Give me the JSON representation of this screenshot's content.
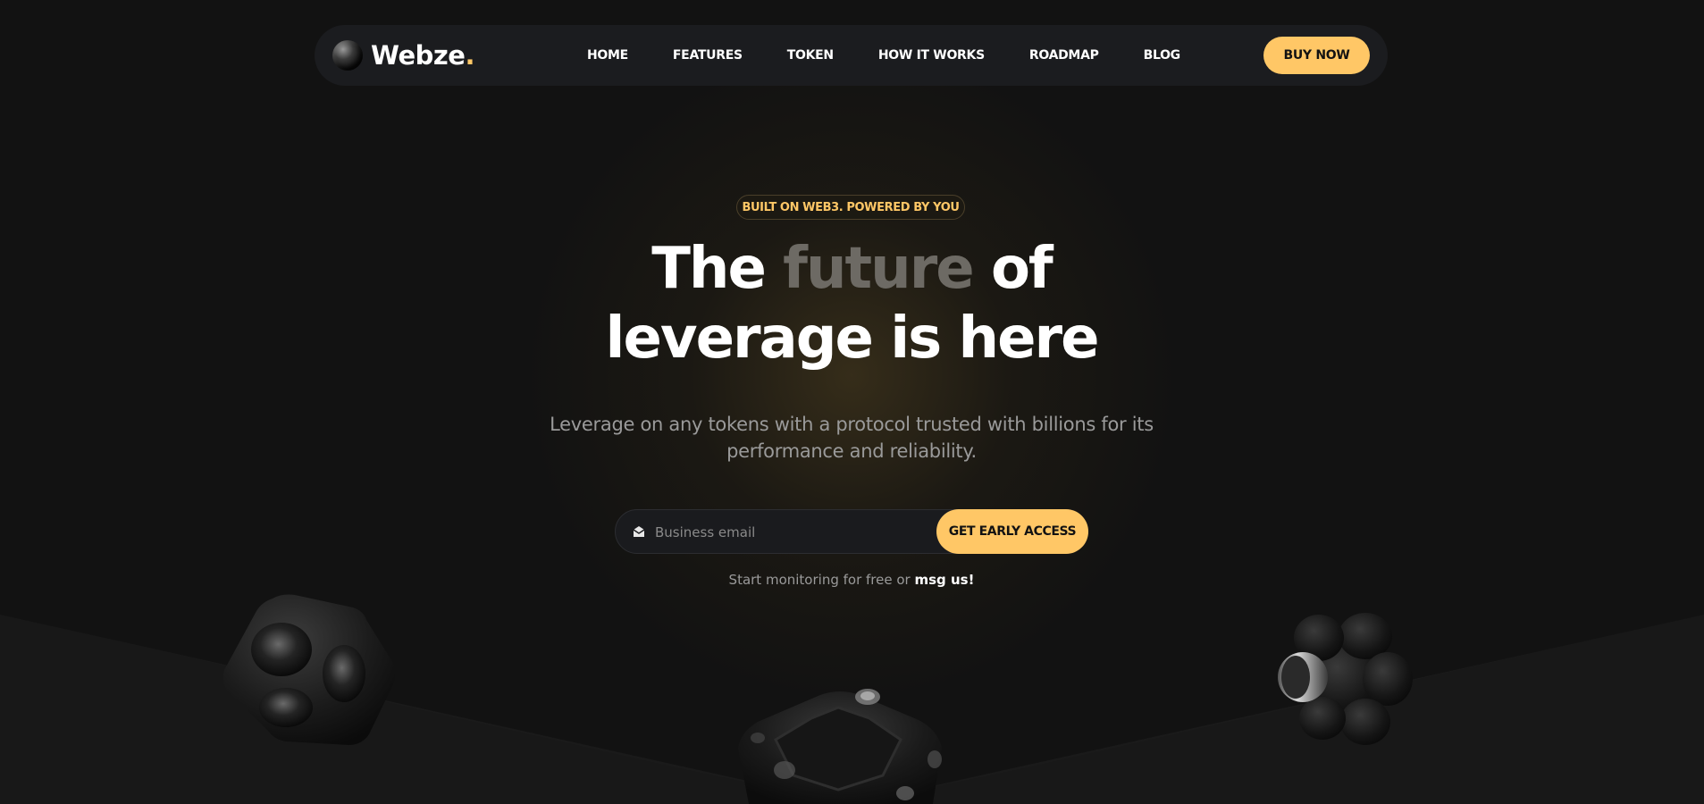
{
  "brand": {
    "name": "Webze",
    "dot": ".",
    "accent_color": "#ffc766"
  },
  "nav": {
    "links": [
      "HOME",
      "FEATURES",
      "TOKEN",
      "HOW IT WORKS",
      "ROADMAP",
      "BLOG"
    ],
    "buy_label": "BUY NOW"
  },
  "hero": {
    "badge": "BUILT ON WEB3. POWERED BY YOU",
    "headline_part1": "The ",
    "headline_highlight": "future",
    "headline_part2": " of",
    "headline_line2": "leverage is here",
    "subtitle": "Leverage on any tokens with a protocol trusted with billions for its performance and reliability.",
    "email_placeholder": "Business email",
    "cta_label": "GET EARLY ACCESS",
    "note_text": "Start monitoring for free or ",
    "note_link": "msg us!"
  },
  "icons": {
    "logo": "sphere-logo-icon",
    "email": "envelope-icon"
  }
}
